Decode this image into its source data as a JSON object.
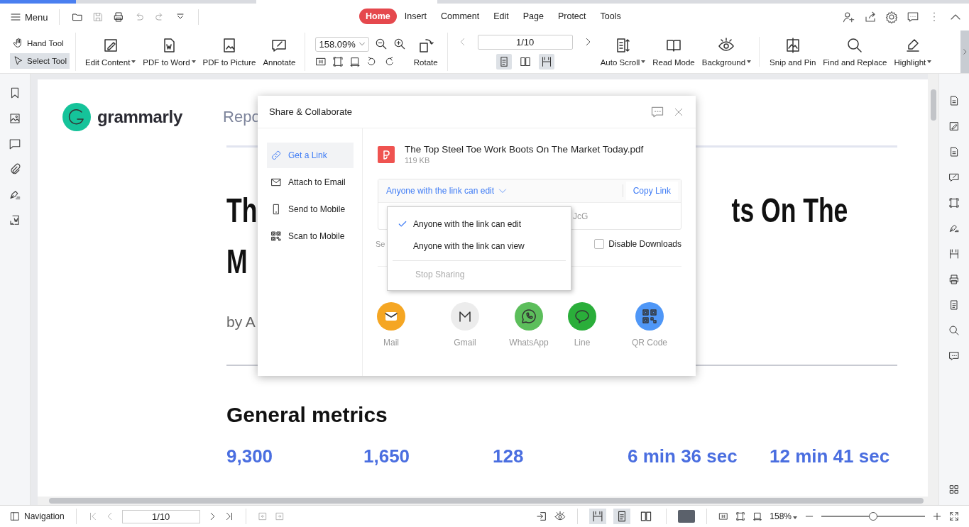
{
  "menu": {
    "label": "Menu"
  },
  "tabs": [
    {
      "label": "Home",
      "selected": true
    },
    {
      "label": "Insert",
      "selected": false
    },
    {
      "label": "Comment",
      "selected": false
    },
    {
      "label": "Edit",
      "selected": false
    },
    {
      "label": "Page",
      "selected": false
    },
    {
      "label": "Protect",
      "selected": false
    },
    {
      "label": "Tools",
      "selected": false
    }
  ],
  "ribbon": {
    "pointer_tools": [
      {
        "label": "Hand Tool",
        "selected": false
      },
      {
        "label": "Select Tool",
        "selected": true
      }
    ],
    "buttons_left": [
      {
        "label": "Edit Content",
        "menu": true
      },
      {
        "label": "PDF to Word",
        "menu": true
      },
      {
        "label": "PDF to Picture",
        "menu": false
      },
      {
        "label": "Annotate",
        "menu": false
      }
    ],
    "zoom": {
      "value": "158.09%"
    },
    "rotate": {
      "label": "Rotate"
    },
    "page": {
      "value": "1/10"
    },
    "view_modes": [
      {
        "selected": true
      },
      {
        "selected": false
      },
      {
        "selected": true
      }
    ],
    "buttons_right": [
      {
        "label": "Auto Scroll",
        "menu": true
      },
      {
        "label": "Read Mode",
        "menu": false
      },
      {
        "label": "Background",
        "menu": true
      },
      {
        "label": "Snip and Pin",
        "menu": false
      },
      {
        "label": "Find and Replace",
        "menu": false
      },
      {
        "label": "Highlight",
        "menu": true
      }
    ]
  },
  "document": {
    "logo_text": "grammarly",
    "header_text": "Repo",
    "title_start": "Th",
    "title_end": "ts On The",
    "title_line2": "M",
    "byline": "by A",
    "section_title": "General metrics",
    "metrics": [
      "9,300",
      "1,650",
      "128",
      "6 min 36 sec",
      "12 min 41 sec"
    ]
  },
  "dialog": {
    "title": "Share & Collaborate",
    "nav": [
      {
        "label": "Get a Link",
        "kind": "link",
        "selected": true
      },
      {
        "label": "Attach to Email",
        "kind": "email",
        "selected": false
      },
      {
        "label": "Send to Mobile",
        "kind": "mobile",
        "selected": false
      },
      {
        "label": "Scan to Mobile",
        "kind": "qr",
        "selected": false
      }
    ],
    "file": {
      "name": "The Top Steel Toe Work Boots On The Market Today.pdf",
      "size": "119 KB"
    },
    "permission": "Anyone with the link can edit",
    "copy_link": "Copy Link",
    "link_tail": "JcG",
    "setting_fragment": "Se",
    "disable_downloads": {
      "label": "Disable Downloads",
      "checked": false
    },
    "share_targets": [
      {
        "label": "Mail",
        "kind": "mail",
        "color": "#f5a623"
      },
      {
        "label": "Gmail",
        "kind": "gmail",
        "color": "#ececec"
      },
      {
        "label": "WhatsApp",
        "kind": "whatsapp",
        "color": "#5cbe5b"
      },
      {
        "label": "Line",
        "kind": "line",
        "color": "#2aae3a"
      },
      {
        "label": "QR Code",
        "kind": "qr",
        "color": "#4f97f7"
      }
    ],
    "dropdown": [
      {
        "label": "Anyone with the link can edit",
        "selected": true,
        "disabled": false
      },
      {
        "label": "Anyone with the link can view",
        "selected": false,
        "disabled": false
      },
      {
        "label": "Stop Sharing",
        "selected": false,
        "disabled": true
      }
    ]
  },
  "status_bar": {
    "navigation": "Navigation",
    "page": "1/10",
    "zoom": "158%",
    "zoom_level": {
      "level": 0.5
    }
  }
}
